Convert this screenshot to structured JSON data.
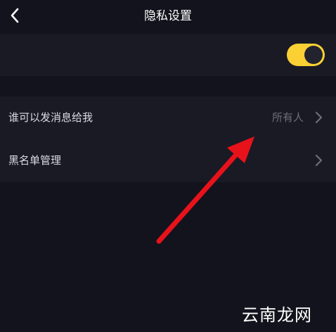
{
  "header": {
    "back_icon": "chevron-left-icon",
    "title": "隐私设置"
  },
  "toggle_row": {
    "enabled": true,
    "accent_color": "#fbd034"
  },
  "settings": {
    "rows": [
      {
        "label": "谁可以发消息给我",
        "value": "所有人",
        "icon": "chevron-right-icon"
      },
      {
        "label": "黑名单管理",
        "icon": "chevron-right-icon"
      }
    ]
  },
  "annotation": {
    "arrow_color": "#e8121b"
  },
  "watermark": "云南龙网"
}
